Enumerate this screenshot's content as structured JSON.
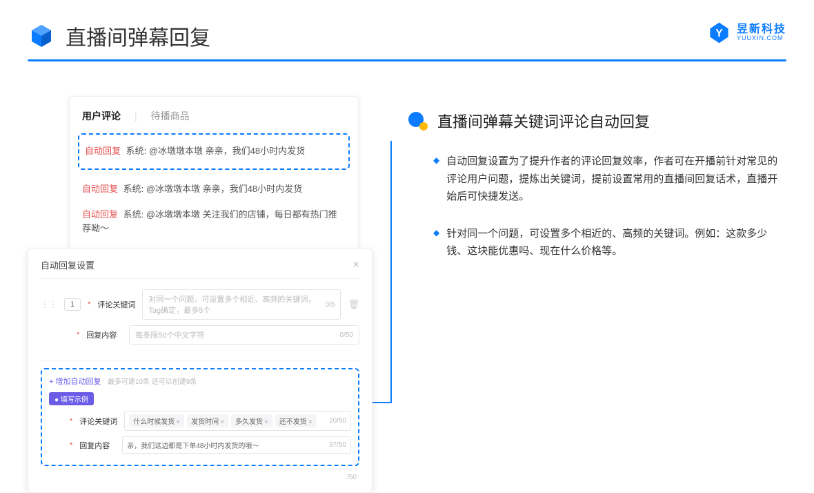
{
  "header": {
    "title": "直播间弹幕回复"
  },
  "logo": {
    "cn": "昱新科技",
    "en": "YUUXIN.COM"
  },
  "card1": {
    "tab_active": "用户评论",
    "tab_inactive": "待播商品",
    "auto_tag": "自动回复",
    "comment1": "系统: @冰墩墩本墩 亲亲，我们48小时内发货",
    "comment2": "系统: @冰墩墩本墩 亲亲，我们48小时内发货",
    "comment3": "系统: @冰墩墩本墩 关注我们的店铺，每日都有热门推荐呦～"
  },
  "card2": {
    "title": "自动回复设置",
    "num": "1",
    "kw_label": "评论关键词",
    "kw_placeholder": "对同一个问题，可设置多个相近、高频的关键词，Tag确定，最多5个",
    "kw_count": "0/5",
    "content_label": "回复内容",
    "content_placeholder": "每条限50个中文字符",
    "content_count": "0/50",
    "add_link": "+ 增加自动回复",
    "add_hint": "最多可建10条 还可以创建9条",
    "example_tag": "● 填写示例",
    "ex_kw_label": "评论关键词",
    "chips": [
      "什么时候发货",
      "发货时间",
      "多久发货",
      "还不发货"
    ],
    "ex_kw_count": "20/50",
    "ex_content_label": "回复内容",
    "ex_content": "亲，我们这边都是下单48小时内发货的哦～",
    "ex_content_count": "37/50",
    "bottom_count": "/50"
  },
  "right": {
    "section_title": "直播间弹幕关键词评论自动回复",
    "bullet1": "自动回复设置为了提升作者的评论回复效率，作者可在开播前针对常见的评论用户问题，提炼出关键词，提前设置常用的直播间回复话术，直播开始后可快捷发送。",
    "bullet2": "针对同一个问题，可设置多个相近的、高频的关键词。例如：这款多少钱、这块能优惠吗、现在什么价格等。"
  }
}
